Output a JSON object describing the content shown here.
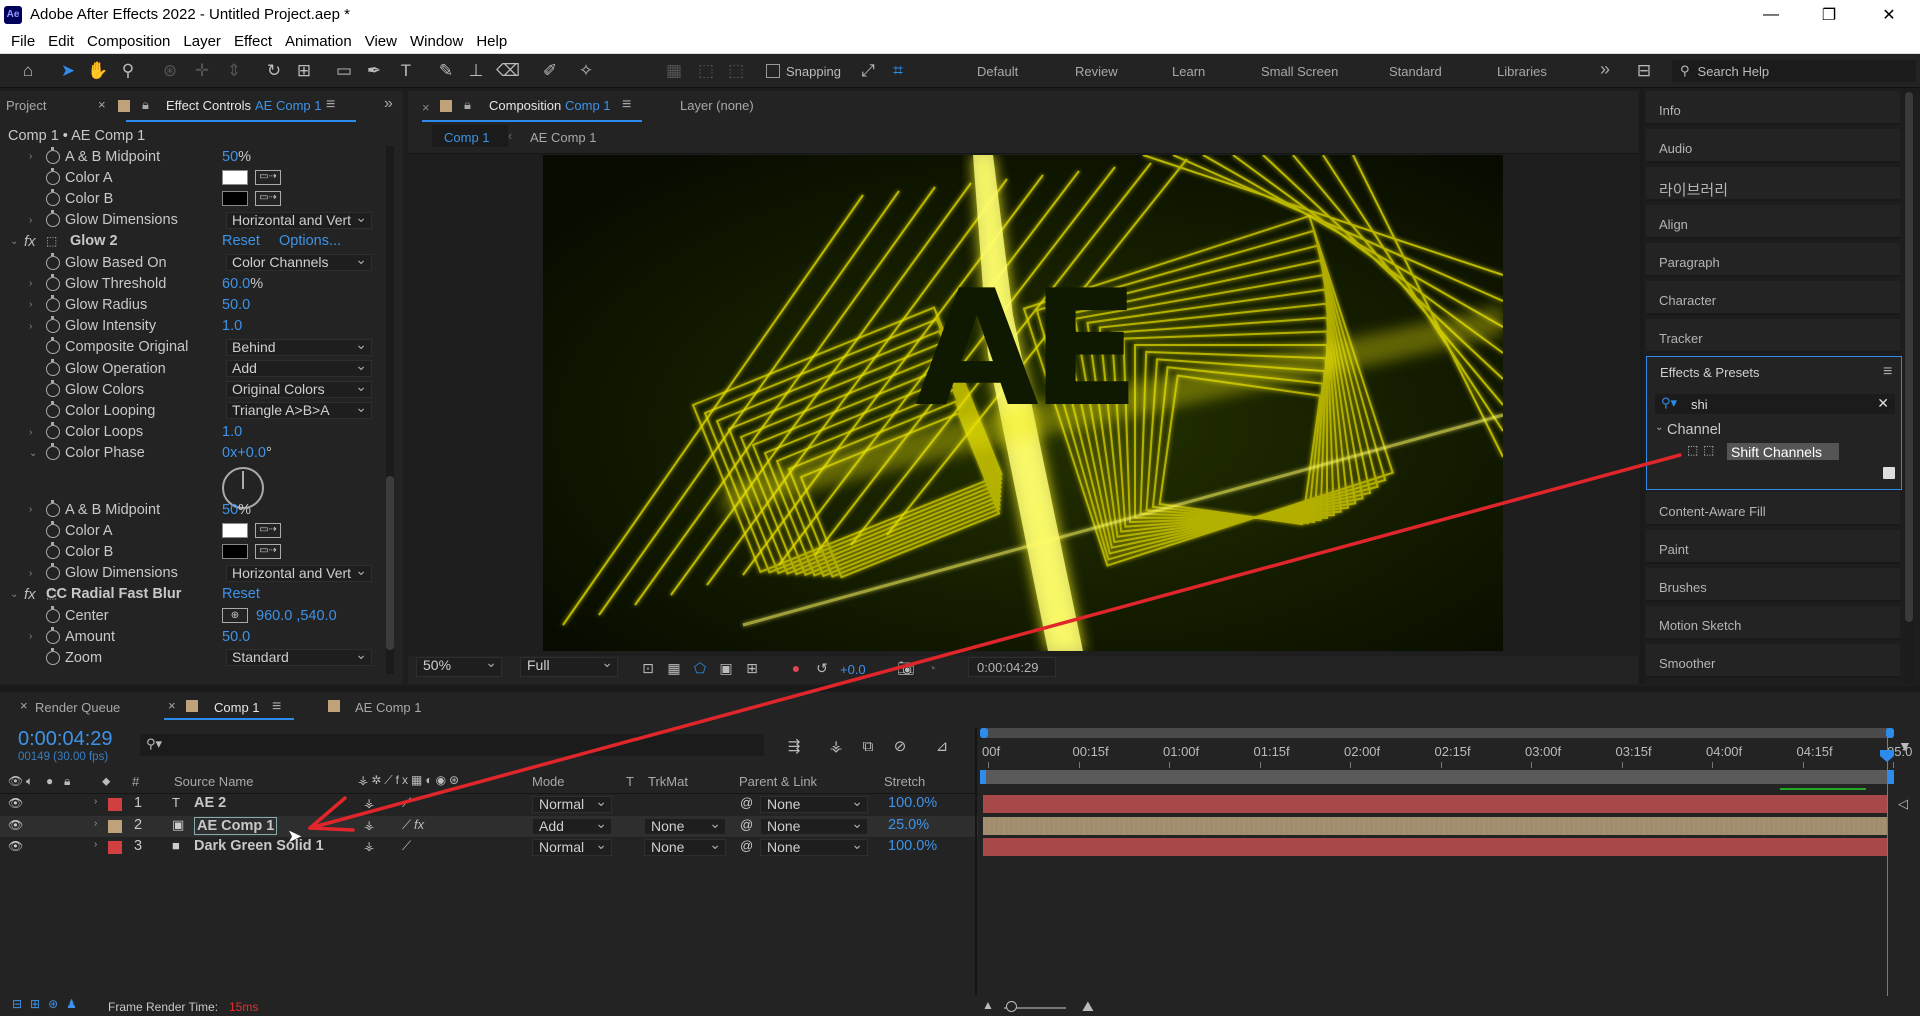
{
  "title_bar": {
    "app_logo": "Ae",
    "title": "Adobe After Effects 2022 - Untitled Project.aep *",
    "minimize": "—",
    "maximize": "❐",
    "close": "✕"
  },
  "menu": [
    "File",
    "Edit",
    "Composition",
    "Layer",
    "Effect",
    "Animation",
    "View",
    "Window",
    "Help"
  ],
  "toolbar": {
    "snapping_label": "Snapping",
    "workspaces": [
      "Default",
      "Review",
      "Learn",
      "Small Screen",
      "Standard",
      "Libraries"
    ],
    "overflow": "»",
    "search_help_placeholder": "Search Help"
  },
  "effect_controls": {
    "tab_project": "Project",
    "tab_label": "Effect Controls",
    "tab_target": "AE Comp 1",
    "breadcrumb": "Comp 1 • AE Comp 1",
    "rows": [
      {
        "kind": "value",
        "label": "A & B Midpoint",
        "value": "50",
        "unit": "%"
      },
      {
        "kind": "color",
        "label": "Color A",
        "color": "#ffffff"
      },
      {
        "kind": "color",
        "label": "Color B",
        "color": "#000000"
      },
      {
        "kind": "dropdown",
        "label": "Glow Dimensions",
        "value": "Horizontal and Vert"
      },
      {
        "kind": "fx",
        "label": "Glow 2",
        "reset": "Reset",
        "options": "Options..."
      },
      {
        "kind": "dropdown",
        "label": "Glow Based On",
        "value": "Color Channels"
      },
      {
        "kind": "value",
        "label": "Glow Threshold",
        "value": "60.0",
        "unit": "%"
      },
      {
        "kind": "value",
        "label": "Glow Radius",
        "value": "50.0",
        "unit": ""
      },
      {
        "kind": "value",
        "label": "Glow Intensity",
        "value": "1.0",
        "unit": ""
      },
      {
        "kind": "dropdown",
        "label": "Composite Original",
        "value": "Behind"
      },
      {
        "kind": "dropdown",
        "label": "Glow Operation",
        "value": "Add"
      },
      {
        "kind": "dropdown",
        "label": "Glow Colors",
        "value": "Original Colors"
      },
      {
        "kind": "dropdown",
        "label": "Color Looping",
        "value": "Triangle A>B>A"
      },
      {
        "kind": "value",
        "label": "Color Loops",
        "value": "1.0",
        "unit": ""
      },
      {
        "kind": "phase",
        "label": "Color Phase",
        "value": "0x+0.0",
        "unit": "°"
      },
      {
        "kind": "value",
        "label": "A & B Midpoint",
        "value": "50",
        "unit": "%"
      },
      {
        "kind": "color",
        "label": "Color A",
        "color": "#ffffff"
      },
      {
        "kind": "color",
        "label": "Color B",
        "color": "#000000"
      },
      {
        "kind": "dropdown",
        "label": "Glow Dimensions",
        "value": "Horizontal and Vert"
      },
      {
        "kind": "fx",
        "label": "CC Radial Fast Blur",
        "reset": "Reset",
        "options": ""
      },
      {
        "kind": "point",
        "label": "Center",
        "value": "960.0 ,540.0"
      },
      {
        "kind": "value",
        "label": "Amount",
        "value": "50.0",
        "unit": ""
      },
      {
        "kind": "dropdown",
        "label": "Zoom",
        "value": "Standard"
      }
    ]
  },
  "composition": {
    "tab_label": "Composition",
    "tab_target": "Comp 1",
    "layer_tab": "Layer (none)",
    "crumbs": [
      "Comp 1",
      "AE Comp 1"
    ],
    "viewer_text": "AE",
    "zoom": "50%",
    "resolution": "Full",
    "exposure": "+0.0",
    "timecode": "0:00:04:29"
  },
  "right_panels": [
    "Info",
    "Audio",
    "라이브러리",
    "Align",
    "Paragraph",
    "Character",
    "Tracker"
  ],
  "effects_presets": {
    "title": "Effects & Presets",
    "search_value": "shi",
    "category": "Channel",
    "result": "Shift Channels"
  },
  "right_panels_lower": [
    "Content-Aware Fill",
    "Paint",
    "Brushes",
    "Motion Sketch",
    "Smoother"
  ],
  "timeline": {
    "tab_render": "Render Queue",
    "tab_comp1": "Comp 1",
    "tab_aecomp": "AE Comp 1",
    "timecode": "0:00:04:29",
    "frames": "00149 (30.00 fps)",
    "col_num": "#",
    "col_source": "Source Name",
    "col_mode": "Mode",
    "col_t": "T",
    "col_trkmat": "TrkMat",
    "col_parent": "Parent & Link",
    "col_stretch": "Stretch",
    "ticks": [
      "00f",
      "00:15f",
      "01:00f",
      "01:15f",
      "02:00f",
      "02:15f",
      "03:00f",
      "03:15f",
      "04:00f",
      "04:15f",
      "05:0"
    ],
    "layers": [
      {
        "num": "1",
        "label_color": "#d14040",
        "type_icon": "T",
        "name": "AE 2",
        "mode": "Normal",
        "trkmat": "",
        "parent": "None",
        "stretch": "100.0%",
        "bar_color": "#a84848"
      },
      {
        "num": "2",
        "label_color": "#bfa27a",
        "type_icon": "▣",
        "name": "AE Comp 1",
        "mode": "Add",
        "trkmat": "None",
        "parent": "None",
        "stretch": "25.0%",
        "bar_color": "#a28c6e"
      },
      {
        "num": "3",
        "label_color": "#d14040",
        "type_icon": "■",
        "name": "Dark Green Solid 1",
        "mode": "Normal",
        "trkmat": "None",
        "parent": "None",
        "stretch": "100.0%",
        "bar_color": "#a84848"
      }
    ],
    "frame_render_label": "Frame Render Time:",
    "frame_render_value": "15ms"
  },
  "colors": {
    "accent": "#2d8ceb",
    "annotation_arrow": "#e0262b",
    "glow": "#e8e200"
  }
}
